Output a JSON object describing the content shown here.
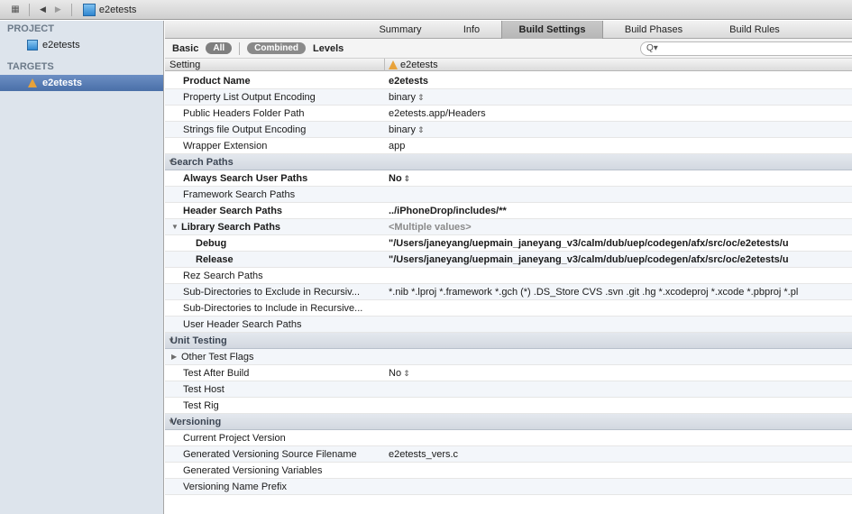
{
  "topbar": {
    "crumb": "e2etests",
    "back_icon": "back-arrow",
    "forward_icon": "forward-arrow",
    "grid_icon": "grid"
  },
  "sidebar": {
    "project_header": "PROJECT",
    "project_item": "e2etests",
    "targets_header": "TARGETS",
    "target_item": "e2etests"
  },
  "tabs": [
    "Summary",
    "Info",
    "Build Settings",
    "Build Phases",
    "Build Rules"
  ],
  "active_tab": "Build Settings",
  "filter": {
    "basic": "Basic",
    "all": "All",
    "combined": "Combined",
    "levels": "Levels",
    "search_placeholder": "Q▾"
  },
  "columns": {
    "setting": "Setting",
    "target": "e2etests"
  },
  "rows": [
    {
      "kind": "setting",
      "bold": true,
      "name": "Product Name",
      "value": "e2etests"
    },
    {
      "kind": "setting",
      "name": "Property List Output Encoding",
      "value": "binary",
      "stepper": true
    },
    {
      "kind": "setting",
      "name": "Public Headers Folder Path",
      "value": "e2etests.app/Headers"
    },
    {
      "kind": "setting",
      "name": "Strings file Output Encoding",
      "value": "binary",
      "stepper": true
    },
    {
      "kind": "setting",
      "name": "Wrapper Extension",
      "value": "app"
    },
    {
      "kind": "section",
      "name": "Search Paths"
    },
    {
      "kind": "setting",
      "bold": true,
      "name": "Always Search User Paths",
      "value": "No",
      "stepper": true
    },
    {
      "kind": "setting",
      "name": "Framework Search Paths",
      "value": ""
    },
    {
      "kind": "setting",
      "bold": true,
      "name": "Header Search Paths",
      "value": "../iPhoneDrop/includes/**"
    },
    {
      "kind": "group",
      "bold": true,
      "name": "Library Search Paths",
      "value": "<Multiple values>",
      "muted": true
    },
    {
      "kind": "sub",
      "bold": true,
      "name": "Debug",
      "value": "\"/Users/janeyang/uepmain_janeyang_v3/calm/dub/uep/codegen/afx/src/oc/e2etests/u"
    },
    {
      "kind": "sub",
      "bold": true,
      "name": "Release",
      "value": "\"/Users/janeyang/uepmain_janeyang_v3/calm/dub/uep/codegen/afx/src/oc/e2etests/u"
    },
    {
      "kind": "setting",
      "name": "Rez Search Paths",
      "value": ""
    },
    {
      "kind": "setting",
      "name": "Sub-Directories to Exclude in Recursiv...",
      "value": "*.nib *.lproj *.framework *.gch (*) .DS_Store CVS .svn .git .hg *.xcodeproj *.xcode *.pbproj *.pl"
    },
    {
      "kind": "setting",
      "name": "Sub-Directories to Include in Recursive...",
      "value": ""
    },
    {
      "kind": "setting",
      "name": "User Header Search Paths",
      "value": ""
    },
    {
      "kind": "section",
      "name": "Unit Testing"
    },
    {
      "kind": "collapsed",
      "name": "Other Test Flags",
      "value": ""
    },
    {
      "kind": "setting",
      "name": "Test After Build",
      "value": "No",
      "stepper": true
    },
    {
      "kind": "setting",
      "name": "Test Host",
      "value": ""
    },
    {
      "kind": "setting",
      "name": "Test Rig",
      "value": ""
    },
    {
      "kind": "section",
      "name": "Versioning"
    },
    {
      "kind": "setting",
      "name": "Current Project Version",
      "value": ""
    },
    {
      "kind": "setting",
      "name": "Generated Versioning Source Filename",
      "value": "e2etests_vers.c"
    },
    {
      "kind": "setting",
      "name": "Generated Versioning Variables",
      "value": ""
    },
    {
      "kind": "setting",
      "name": "Versioning Name Prefix",
      "value": ""
    }
  ]
}
